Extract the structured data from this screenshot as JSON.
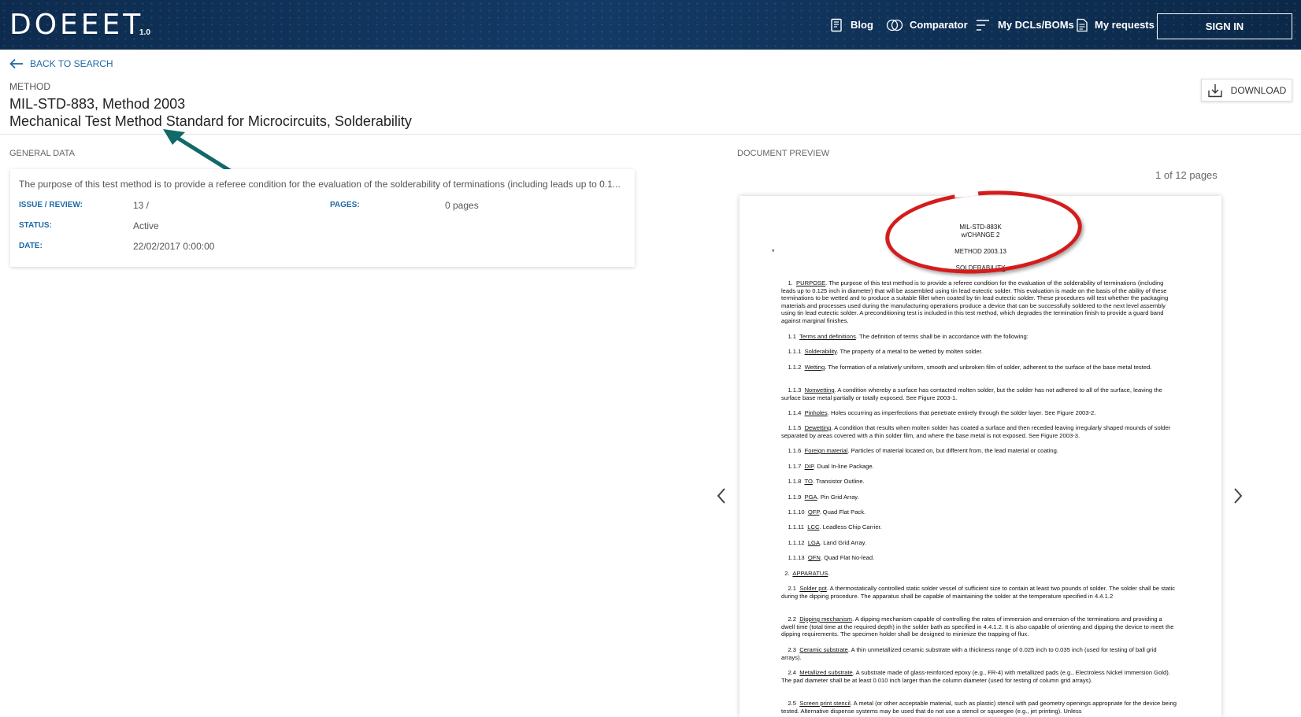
{
  "header": {
    "logo": "DOEEET",
    "version": "1.0",
    "nav": {
      "blog": "Blog",
      "comparator": "Comparator",
      "dcls": "My DCLs/BOMs",
      "requests": "My requests",
      "signin": "SIGN IN"
    }
  },
  "page": {
    "back": "BACK TO SEARCH",
    "type_label": "METHOD",
    "title": "MIL-STD-883, Method 2003",
    "subtitle": "Mechanical Test Method Standard for Microcircuits, Solderability",
    "download": "DOWNLOAD"
  },
  "general": {
    "section": "GENERAL DATA",
    "description": "The purpose of this test method is to provide a referee condition for the evaluation of the solderability of terminations (including leads up to 0.1...",
    "fields": {
      "issue_label": "ISSUE / REVIEW:",
      "issue_value": "13 /",
      "pages_label": "PAGES:",
      "pages_value": "0 pages",
      "status_label": "STATUS:",
      "status_value": "Active",
      "date_label": "DATE:",
      "date_value": "22/02/2017 0:00:00"
    }
  },
  "preview": {
    "section": "DOCUMENT PREVIEW",
    "page_count": "1 of 12 pages",
    "doc": {
      "header1": "MIL-STD-883K",
      "header2": "w/CHANGE 2",
      "method": "METHOD 2003.13",
      "heading": "SOLDERABILITY",
      "star": "*",
      "p_purpose_num": "1.",
      "p_purpose_title": "PURPOSE",
      "p_purpose": ". The purpose of this test method is to provide a referee condition for the evaluation of the solderability of terminations (including leads up to 0.125 inch in diameter) that will be assembled using tin lead eutectic solder. This evaluation is made on the basis of the ability of these terminations to be wetted and to produce a suitable fillet when coated by tin lead eutectic solder. These procedures will test whether the packaging materials and processes used during the manufacturing operations produce a device that can be successfully soldered to the next level assembly using tin lead eutectic solder. A preconditioning test is included in this test method, which degrades the termination finish to provide a guard band against marginal finishes.",
      "p11_num": "1.1",
      "p11_title": "Terms and definitions",
      "p11": ". The definition of terms shall be in accordance with the following:",
      "p111_num": "1.1.1",
      "p111_title": "Solderability",
      "p111": ". The property of a metal to be wetted by molten solder.",
      "p112_num": "1.1.2",
      "p112_title": "Wetting",
      "p112": ". The formation of a relatively uniform, smooth and unbroken film of solder, adherent to the surface of the base metal tested.",
      "p113_num": "1.1.3",
      "p113_title": "Nonwetting",
      "p113": ". A condition whereby a surface has contacted molten solder, but the solder has not adhered to all of the surface, leaving the surface base metal partially or totally exposed. See Figure 2003-1.",
      "p114_num": "1.1.4",
      "p114_title": "Pinholes",
      "p114": ". Holes occurring as imperfections that penetrate entirely through the solder layer. See Figure 2003-2.",
      "p115_num": "1.1.5",
      "p115_title": "Dewetting",
      "p115": ". A condition that results when molten solder has coated a surface and then receded leaving irregularly shaped mounds of solder separated by areas covered with a thin solder film, and where the base metal is not exposed. See Figure 2003-3.",
      "p116_num": "1.1.6",
      "p116_title": "Foreign material",
      "p116": ". Particles of material located on, but different from, the lead material or coating.",
      "p117_num": "1.1.7",
      "p117_title": "DIP",
      "p117": ". Dual In-line Package.",
      "p118_num": "1.1.8",
      "p118_title": "TO",
      "p118": ". Transistor Outline.",
      "p119_num": "1.1.9",
      "p119_title": "PGA",
      "p119": ". Pin Grid Array.",
      "p1110_num": "1.1.10",
      "p1110_title": "QFP",
      "p1110": ". Quad Flat Pack.",
      "p1111_num": "1.1.11",
      "p1111_title": "LCC",
      "p1111": ". Leadless Chip Carrier.",
      "p1112_num": "1.1.12",
      "p1112_title": "LGA",
      "p1112": ". Land Grid Array.",
      "p1113_num": "1.1.13",
      "p1113_title": "QFN",
      "p1113": ". Quad Flat No-lead.",
      "p2_num": "2.",
      "p2_title": "APPARATUS",
      "p2": ".",
      "p21_num": "2.1",
      "p21_title": "Solder pot",
      "p21": ". A thermostatically controlled static solder vessel of sufficient size to contain at least two pounds of solder. The solder shall be static during the dipping procedure. The apparatus shall be capable of maintaining the solder at the temperature specified in 4.4.1.2",
      "p22_num": "2.2",
      "p22_title": "Dipping mechanism",
      "p22": ". A dipping mechanism capable of controlling the rates of immersion and emersion of the terminations and providing a dwell time (total time at the required depth) in the solder bath as specified in 4.4.1.2. It is also capable of orienting and dipping the device to meet the dipping requirements. The specimen holder shall be designed to minimize the trapping of flux.",
      "p23_num": "2.3",
      "p23_title": "Ceramic substrate",
      "p23": ". A thin unmetallized ceramic substrate with a thickness range of 0.025 inch to 0.035 inch (used for testing of ball grid arrays).",
      "p24_num": "2.4",
      "p24_title": "Metallized substrate",
      "p24": ". A substrate made of glass-reinforced epoxy (e.g., FR-4) with metallized pads (e.g., Electroless Nickel Immersion Gold). The pad diameter shall be at least 0.010 inch larger than the column diameter (used for testing of column grid arrays).",
      "p25_num": "2.5",
      "p25_title": "Screen print stencil",
      "p25": ". A metal (or other acceptable material, such as plastic) stencil with pad geometry openings appropriate for the device being tested. Alternative dispense systems may be used that do not use a stencil or squeegee (e.g., jet printing). Unless"
    }
  }
}
